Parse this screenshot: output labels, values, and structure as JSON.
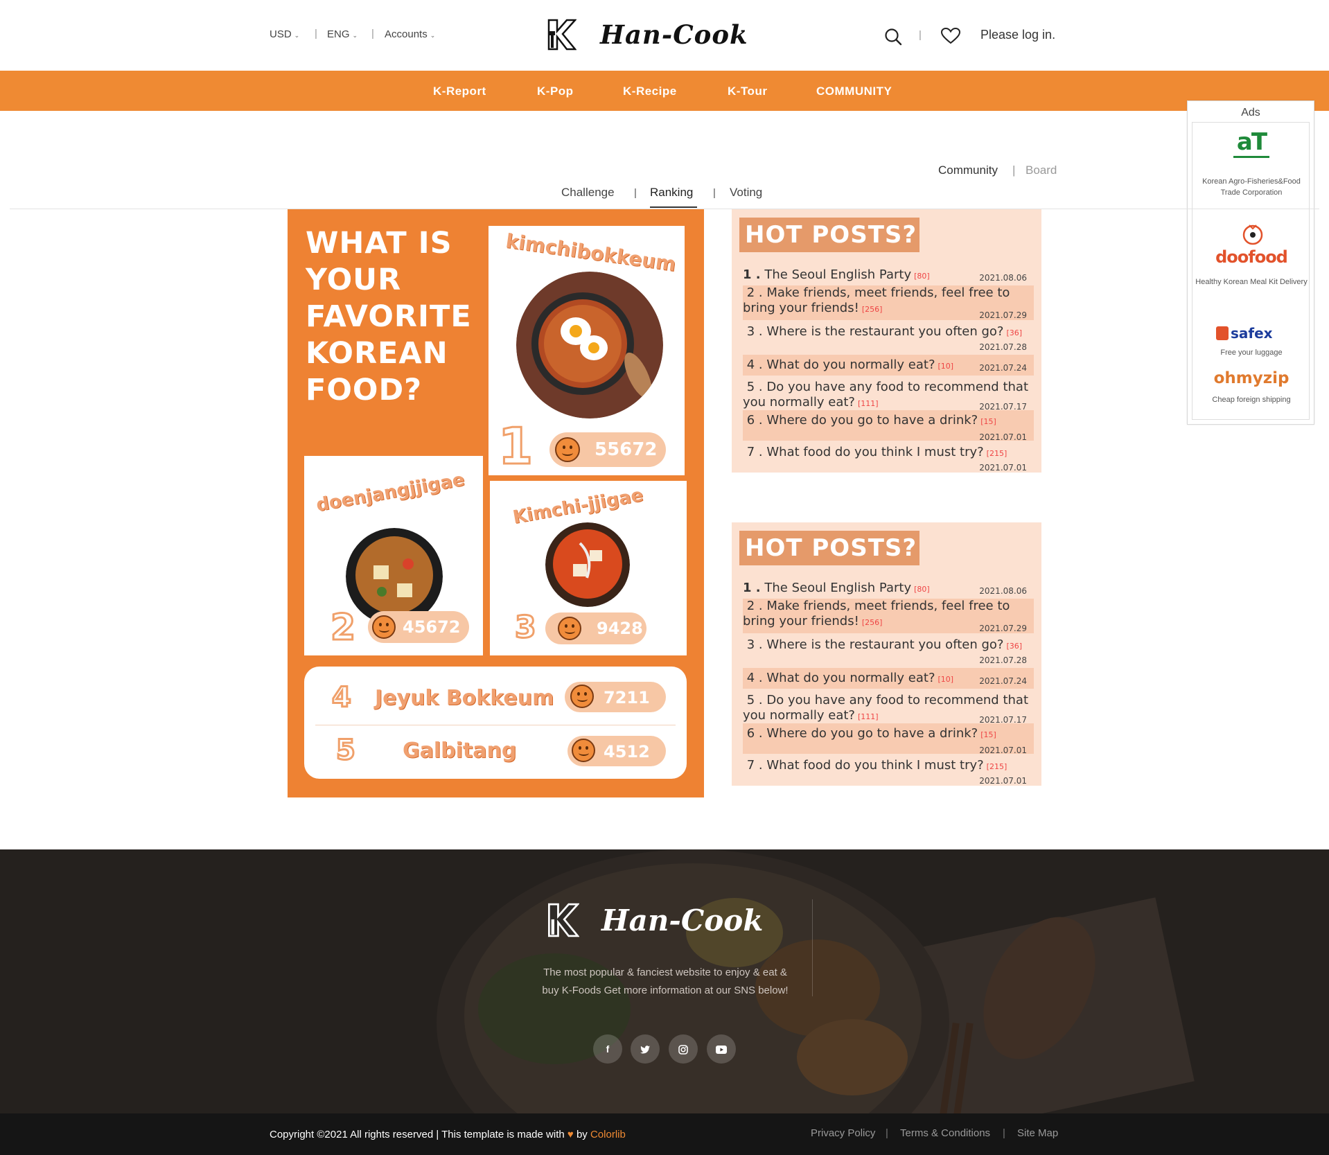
{
  "header": {
    "currency": "USD",
    "language": "ENG",
    "accounts": "Accounts",
    "brand": "Han-Cook",
    "login": "Please log in."
  },
  "nav": [
    "K-Report",
    "K-Pop",
    "K-Recipe",
    "K-Tour",
    "COMMUNITY"
  ],
  "ads": {
    "title": "Ads",
    "items": [
      {
        "logo": "aT",
        "caption": "Korean Agro-Fisheries&Food Trade Corporation"
      },
      {
        "logo": "doofood",
        "caption": "Healthy Korean Meal Kit Delivery"
      },
      {
        "logo": "safex",
        "caption": "Free your luggage"
      },
      {
        "logo": "ohmyzip",
        "caption": "Cheap foreign shipping"
      }
    ]
  },
  "breadcrumb": {
    "community": "Community",
    "board": "Board"
  },
  "tabs": [
    "Challenge",
    "Ranking",
    "Voting"
  ],
  "ranking": {
    "question": [
      "WHAT IS",
      "YOUR",
      "FAVORITE",
      "KOREAN",
      "FOOD?"
    ],
    "items": [
      {
        "rank": "1",
        "name": "kimchibokkeum",
        "score": "55672"
      },
      {
        "rank": "2",
        "name": "doenjangjjigae",
        "score": "45672"
      },
      {
        "rank": "3",
        "name": "Kimchi-jjigae",
        "score": "9428"
      },
      {
        "rank": "4",
        "name": "Jeyuk Bokkeum",
        "score": "7211"
      },
      {
        "rank": "5",
        "name": "Galbitang",
        "score": "4512"
      }
    ]
  },
  "hot_posts": {
    "title": "HOT POSTS?",
    "posts": [
      {
        "n": "1 .",
        "title": "The Seoul English Party",
        "count": "[80]",
        "date": "2021.08.06"
      },
      {
        "n": "2 .",
        "title": "Make friends, meet friends, feel free to bring your friends!",
        "count": "[256]",
        "date": "2021.07.29"
      },
      {
        "n": "3 .",
        "title": "Where is the restaurant you often go?",
        "count": "[36]",
        "date": "2021.07.28"
      },
      {
        "n": "4 .",
        "title": "What do you normally eat?",
        "count": "[10]",
        "date": "2021.07.24"
      },
      {
        "n": "5 .",
        "title": "Do you have any food to recommend that you normally eat?",
        "count": "[111]",
        "date": "2021.07.17"
      },
      {
        "n": "6 .",
        "title": "Where do you go to have a drink?",
        "count": "[15]",
        "date": "2021.07.01"
      },
      {
        "n": "7 .",
        "title": "What food do you think I must try?",
        "count": "[215]",
        "date": "2021.07.01"
      }
    ]
  },
  "footer": {
    "brand": "Han-Cook",
    "description": "The most popular & fanciest website to enjoy & eat & buy K-Foods Get more information at our SNS below!",
    "social": [
      "facebook",
      "twitter",
      "instagram",
      "youtube"
    ],
    "copyright_pre": "Copyright ©2021 All rights reserved | This template is made with",
    "copyright_by": "by",
    "copyright_lib": "Colorlib",
    "links": [
      "Privacy Policy",
      "Terms & Conditions",
      "Site Map"
    ]
  }
}
